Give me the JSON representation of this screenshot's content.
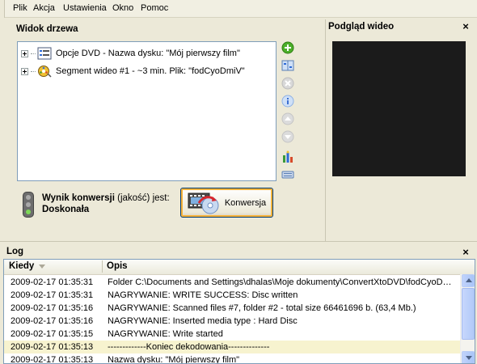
{
  "menu": {
    "items": [
      "Plik",
      "Akcja",
      "Ustawienia",
      "Okno",
      "Pomoc"
    ]
  },
  "tree_panel": {
    "title": "Widok drzewa",
    "items": [
      {
        "label": "Opcje DVD - Nazwa dysku: \"Mój pierwszy film\"",
        "icon": "dvd-options-icon"
      },
      {
        "label": "Segment wideo #1 - ~3 min. Plik: \"fodCyoDmiV\"",
        "icon": "film-reel-icon"
      }
    ],
    "side_buttons": [
      "add-icon",
      "split-icon",
      "remove-icon",
      "info-icon",
      "move-up-icon",
      "move-down-icon",
      "tools-icon",
      "keyboard-icon"
    ]
  },
  "conversion": {
    "result_bold": "Wynik konwersji",
    "result_quality": "(jakość)",
    "result_suffix": "jest:",
    "result_value": "Doskonała",
    "button_label": "Konwersja",
    "quality_level": "green"
  },
  "preview": {
    "title": "Podgląd wideo",
    "close": "×"
  },
  "log": {
    "title": "Log",
    "close": "×",
    "columns": [
      "Kiedy",
      "Opis"
    ],
    "rows": [
      {
        "when": "2009-02-17 01:35:31",
        "desc": "Folder C:\\Documents and Settings\\dhalas\\Moje dokumenty\\ConvertXtoDVD\\fodCyoDm...",
        "highlight": false
      },
      {
        "when": "2009-02-17 01:35:31",
        "desc": "NAGRYWANIE:  WRITE SUCCESS: Disc written",
        "highlight": false
      },
      {
        "when": "2009-02-17 01:35:16",
        "desc": "NAGRYWANIE:  Scanned files #7, folder #2 - total size 66461696 b. (63,4 Mb.)",
        "highlight": false
      },
      {
        "when": "2009-02-17 01:35:16",
        "desc": "NAGRYWANIE:  Inserted media type : Hard Disc",
        "highlight": false
      },
      {
        "when": "2009-02-17 01:35:15",
        "desc": "NAGRYWANIE:  Write started",
        "highlight": false
      },
      {
        "when": "2009-02-17 01:35:13",
        "desc": "-------------Koniec dekodowania--------------",
        "highlight": true
      },
      {
        "when": "2009-02-17 01:35:13",
        "desc": "Nazwa dysku: \"Mój pierwszy film\"",
        "highlight": false
      }
    ]
  }
}
